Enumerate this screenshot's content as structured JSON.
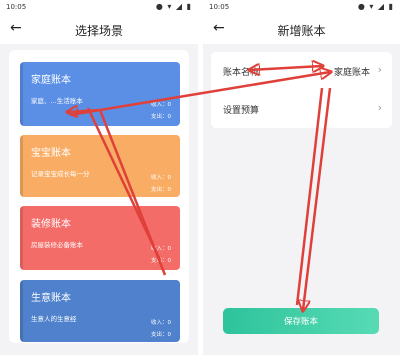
{
  "left": {
    "status": {
      "time": "10:05",
      "icons": "● ▾ ◢ ▮"
    },
    "header": {
      "back": "←",
      "title": "选择场景"
    },
    "scenes": [
      {
        "name": "家庭账本",
        "desc": "家庭、...生活账本",
        "income": "收入：0",
        "expense": "支出：0",
        "color": "#5b8fe6"
      },
      {
        "name": "宝宝账本",
        "desc": "记录宝宝成长每一分",
        "income": "收入：0",
        "expense": "支出：0",
        "color": "#f9ad64"
      },
      {
        "name": "装修账本",
        "desc": "房屋装修必备账本",
        "income": "收入：0",
        "expense": "支出：0",
        "color": "#f46c68"
      },
      {
        "name": "生意账本",
        "desc": "生意人的生意经",
        "income": "收入：0",
        "expense": "支出：0",
        "color": "#4f81cc"
      }
    ]
  },
  "right": {
    "status": {
      "time": "10:05",
      "icons": "● ▾ ◢ ▮"
    },
    "header": {
      "back": "←",
      "title": "新增账本"
    },
    "form": {
      "name_label": "账本名称",
      "name_value": "家庭账本",
      "chevron": "›",
      "budget_label": "设置预算"
    },
    "save_label": "保存账本"
  },
  "colors": {
    "annotation": "#e0403a",
    "save_start": "#2ec39b",
    "save_end": "#57dbb5"
  }
}
